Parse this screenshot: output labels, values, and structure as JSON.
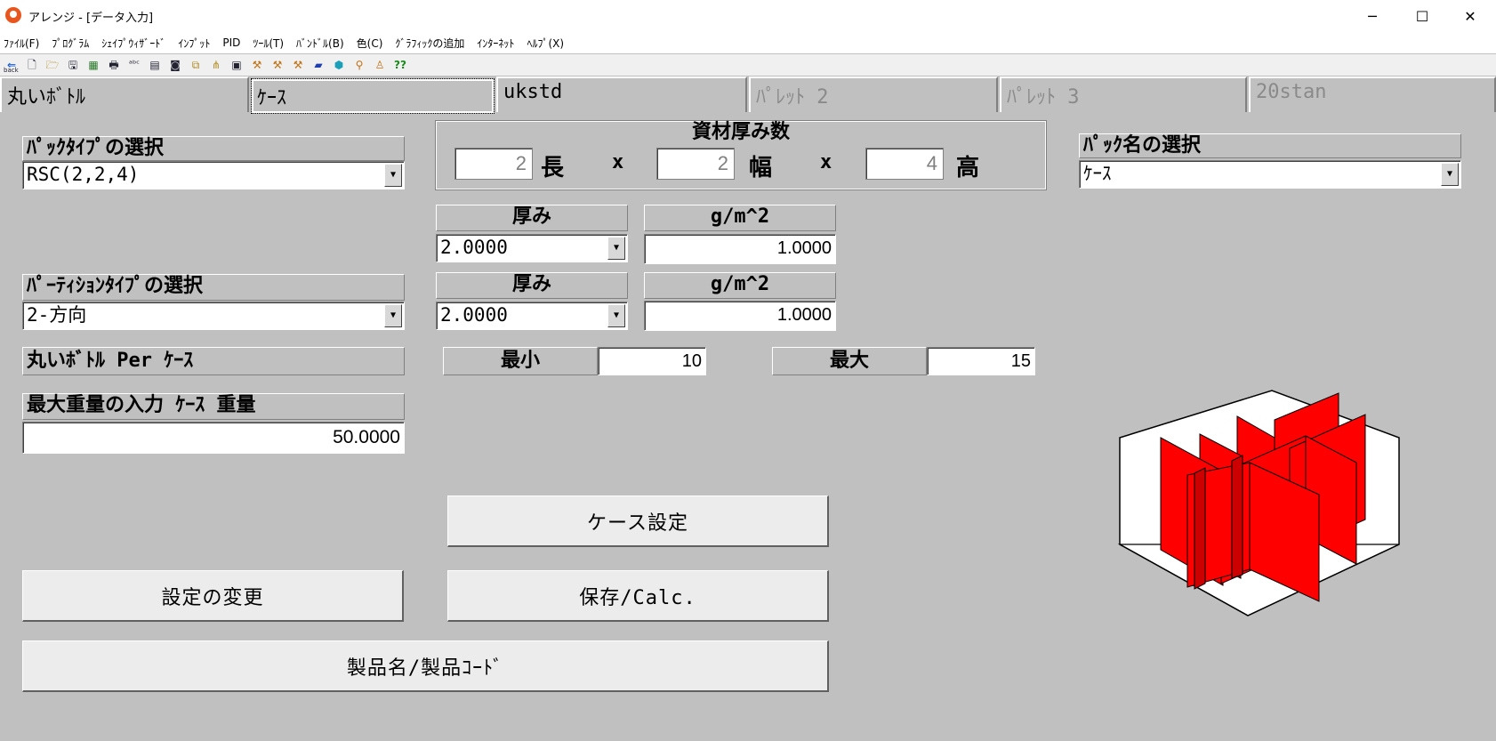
{
  "window": {
    "title": "アレンジ - [データ入力]",
    "controls": [
      "─",
      "☐",
      "✕"
    ]
  },
  "menu": [
    "ﾌｧｲﾙ(F)",
    "ﾌﾟﾛｸﾞﾗﾑ",
    "ｼｪｲﾌﾟｳｨｻﾞｰﾄﾞ",
    "ｲﾝﾌﾟｯﾄ",
    "PID",
    "ﾂｰﾙ(T)",
    "ﾊﾞﾝﾄﾞﾙ(B)",
    "色(C)",
    "ｸﾞﾗﾌｨｯｸの追加",
    "ｲﾝﾀｰﾈｯﾄ",
    "ﾍﾙﾌﾟ(X)"
  ],
  "toolbar": {
    "icons": [
      "back-icon",
      "new-file-icon",
      "open-folder-icon",
      "save-icon",
      "calculator-icon",
      "print-icon",
      "abc-icon",
      "document-icon",
      "camera-icon",
      "copy-icon",
      "tree-icon",
      "properties-icon",
      "tool-a-icon",
      "tool-b-icon",
      "tool-c-icon",
      "book-icon",
      "cube-icon",
      "wand-icon",
      "figure-icon",
      "help-icon"
    ],
    "glyphs": [
      "⇐",
      "🗋",
      "🗁",
      "🖫",
      "▦",
      "🖶",
      "ᵃᵇᶜ",
      "▤",
      "◙",
      "⧉",
      "⋔",
      "▣",
      "⚒",
      "⚒",
      "⚒",
      "▰",
      "⬢",
      "⚲",
      "♙",
      "??"
    ],
    "back_label": "back"
  },
  "tabs": [
    {
      "label": "丸いﾎﾞﾄﾙ",
      "state": "normal"
    },
    {
      "label": "ｹｰｽ",
      "state": "active"
    },
    {
      "label": "ukstd",
      "state": "normal"
    },
    {
      "label": "ﾊﾟﾚｯﾄ 2",
      "state": "dim"
    },
    {
      "label": "ﾊﾟﾚｯﾄ 3",
      "state": "dim"
    },
    {
      "label": "20stan",
      "state": "dim"
    }
  ],
  "pack_type": {
    "label": "ﾊﾟｯｸﾀｲﾌﾟの選択",
    "value": "RSC(2,2,4)"
  },
  "material": {
    "title": "資材厚み数",
    "length": "2",
    "length_unit": "長",
    "width": "2",
    "width_unit": "幅",
    "height": "4",
    "height_unit": "高",
    "times": "x"
  },
  "pack_name": {
    "label": "ﾊﾟｯｸ名の選択",
    "value": "ｹｰｽ"
  },
  "case_thickness": {
    "thick_label": "厚み",
    "thick_value": "2.0000",
    "gsm_label": "g/m^2",
    "gsm_value": "1.0000"
  },
  "partition_type": {
    "label": "ﾊﾟｰﾃｨｼｮﾝﾀｲﾌﾟの選択",
    "value": "2-方向"
  },
  "partition_thickness": {
    "thick_label": "厚み",
    "thick_value": "2.0000",
    "gsm_label": "g/m^2",
    "gsm_value": "1.0000"
  },
  "per_case": {
    "label": "丸いﾎﾞﾄﾙ Per ｹｰｽ",
    "min_label": "最小",
    "min_value": "10",
    "max_label": "最大",
    "max_value": "15"
  },
  "max_weight": {
    "label": "最大重量の入力 ｹｰｽ 重量",
    "value": "50.0000"
  },
  "buttons": {
    "case_settings": "ケース設定",
    "change_settings": "設定の変更",
    "save_calc": "保存/Calc.",
    "product_name": "製品名/製品ｺｰﾄﾞ"
  },
  "colors": {
    "background": "#c0c0c0",
    "partition": "#ff0000"
  }
}
